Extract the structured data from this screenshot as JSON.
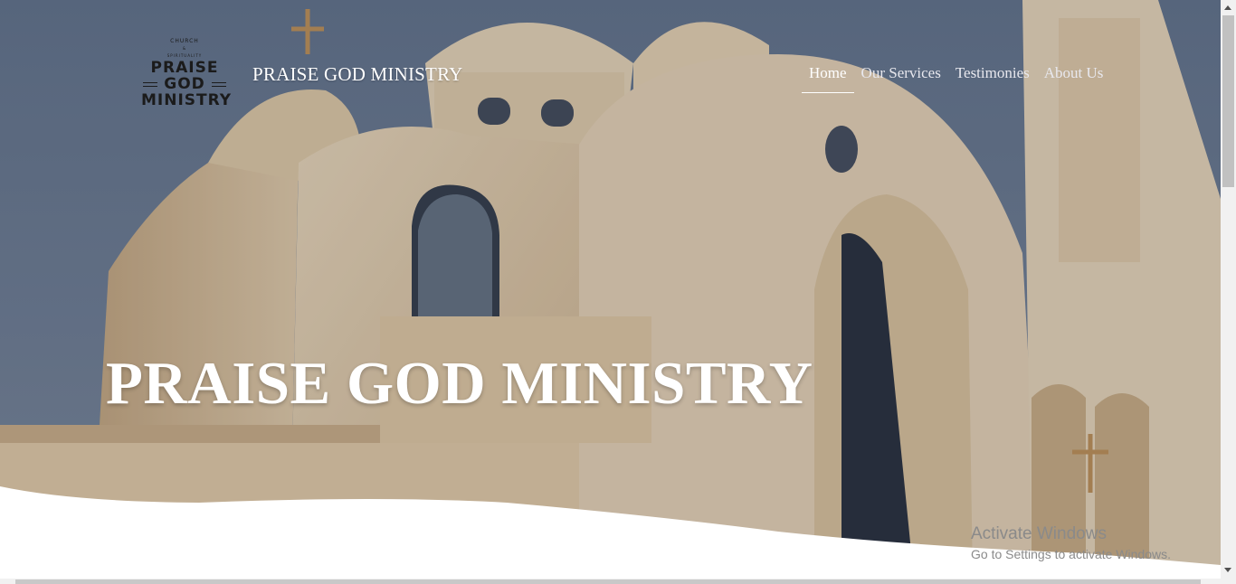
{
  "logo": {
    "top_text": "CHURCH",
    "amp": "&",
    "sub_text": "SPIRITUALITY",
    "line1": "PRAISE",
    "line2": "GOD",
    "line3": "MINISTRY"
  },
  "header": {
    "brand_title": "PRAISE GOD MINISTRY"
  },
  "nav": {
    "items": [
      {
        "label": "Home",
        "active": true
      },
      {
        "label": "Our Services",
        "active": false
      },
      {
        "label": "Testimonies",
        "active": false
      },
      {
        "label": "About Us",
        "active": false
      }
    ]
  },
  "hero": {
    "heading": "PRAISE GOD MINISTRY"
  },
  "watermark": {
    "title": "Activate Windows",
    "subtitle": "Go to Settings to activate Windows."
  },
  "colors": {
    "sky": "#5d7391",
    "building": "#f0dcc0",
    "nav_text": "#ffffff",
    "watermark": "#8a8a8a"
  }
}
